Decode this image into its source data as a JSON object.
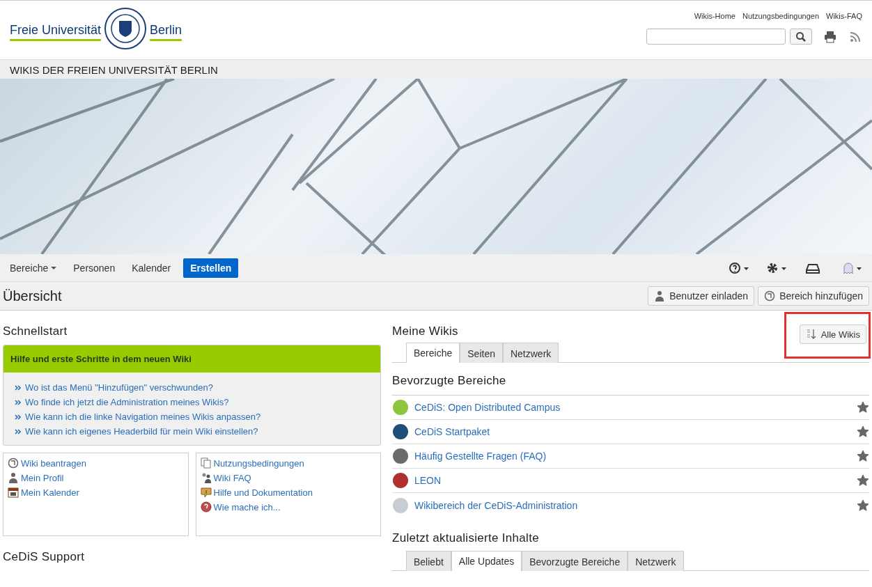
{
  "header": {
    "logo_left": "Freie Universität",
    "logo_right": "Berlin",
    "links": [
      "Wikis-Home",
      "Nutzungsbedingungen",
      "Wikis-FAQ"
    ]
  },
  "site_title": "WIKIS DER FREIEN UNIVERSITÄT BERLIN",
  "nav": {
    "items": [
      {
        "label": "Bereiche",
        "kind": "dropdown"
      },
      {
        "label": "Personen",
        "kind": "link"
      },
      {
        "label": "Kalender",
        "kind": "link"
      },
      {
        "label": "Erstellen",
        "kind": "primary"
      }
    ]
  },
  "page_header": {
    "title": "Übersicht",
    "buttons": [
      {
        "label": "Benutzer einladen"
      },
      {
        "label": "Bereich hinzufügen"
      }
    ]
  },
  "schnellstart": {
    "title": "Schnellstart",
    "panel_title": "Hilfe und erste Schritte in dem neuen Wiki",
    "links": [
      "Wo ist das Menü \"Hinzufügen\" verschwunden?",
      "Wo finde ich jetzt die Administration meines Wikis?",
      "Wie kann ich die linke Navigation meines Wikis anpassen?",
      "Wie kann ich eigenes Headerbild für mein Wiki einstellen?"
    ],
    "boxes": [
      [
        {
          "label": "Wiki beantragen"
        },
        {
          "label": "Mein Profil"
        },
        {
          "label": "Mein Kalender"
        }
      ],
      [
        {
          "label": "Nutzungsbedingungen"
        },
        {
          "label": "Wiki FAQ"
        },
        {
          "label": "Hilfe und Dokumentation"
        },
        {
          "label": "Wie mache ich..."
        }
      ]
    ]
  },
  "support": {
    "title": "CeDiS Support"
  },
  "meine_wikis": {
    "title": "Meine Wikis",
    "all_button": {
      "label": "Alle Wikis",
      "highlighted": true
    },
    "tabs": [
      {
        "label": "Bereiche",
        "selected": true
      },
      {
        "label": "Seiten",
        "selected": false
      },
      {
        "label": "Netzwerk",
        "selected": false
      }
    ],
    "favorites_title": "Bevorzugte Bereiche",
    "spaces": [
      {
        "name": "CeDiS: Open Distributed Campus",
        "starred": true,
        "color": "#8cc63f"
      },
      {
        "name": "CeDiS Startpaket",
        "starred": true,
        "color": "#1f4e79"
      },
      {
        "name": "Häufig Gestellte Fragen (FAQ)",
        "starred": true,
        "color": "#6b6b6b"
      },
      {
        "name": "LEON",
        "starred": true,
        "color": "#b03030"
      },
      {
        "name": "Wikibereich der CeDiS-Administration",
        "starred": true,
        "color": "#c8ccd4"
      }
    ]
  },
  "recent": {
    "title": "Zuletzt aktualisierte Inhalte",
    "tabs": [
      {
        "label": "Beliebt",
        "selected": false
      },
      {
        "label": "Alle Updates",
        "selected": true
      },
      {
        "label": "Bevorzugte Bereiche",
        "selected": false
      },
      {
        "label": "Netzwerk",
        "selected": false
      }
    ]
  }
}
